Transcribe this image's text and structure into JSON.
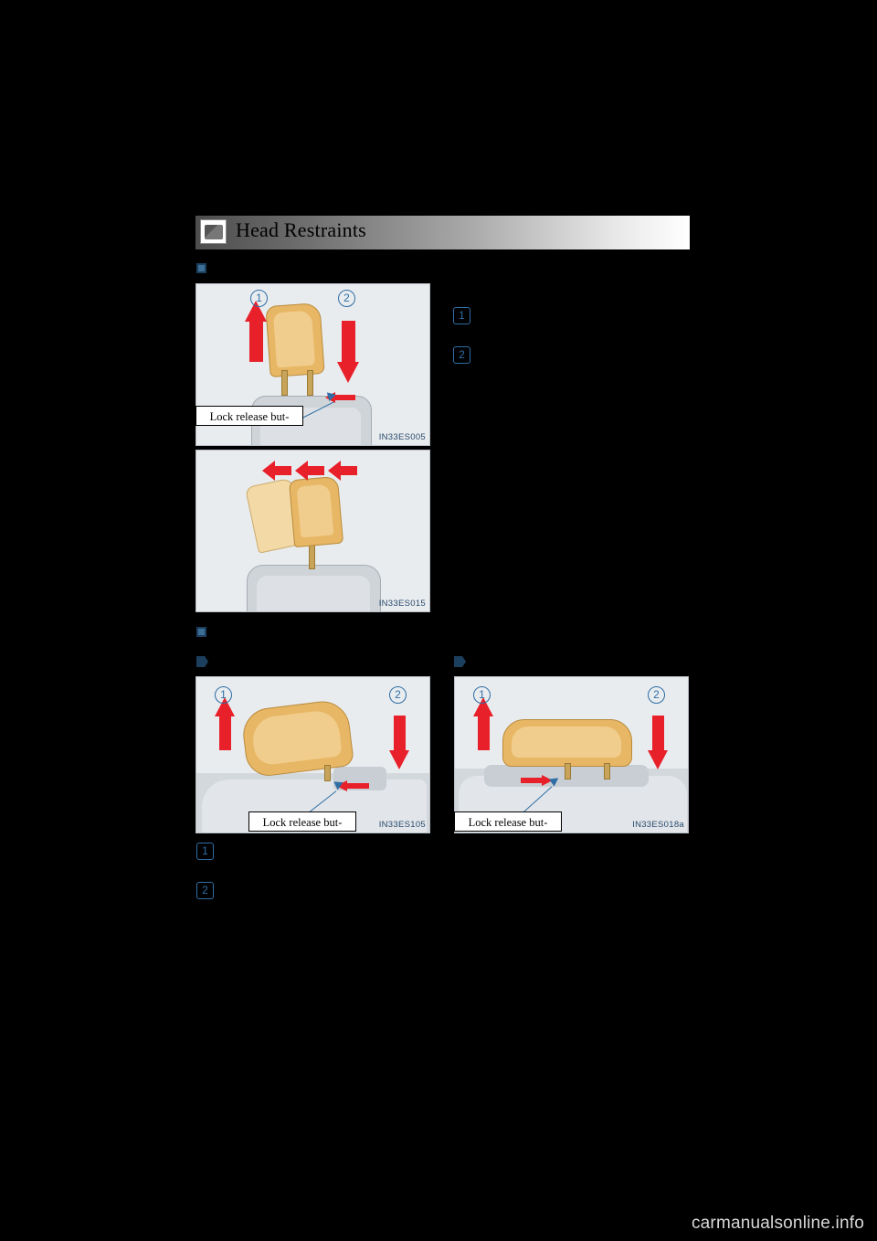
{
  "header": {
    "title": "Head Restraints",
    "icon": "seat-icon"
  },
  "sections": [
    {
      "marker": "section-marker",
      "figures": [
        {
          "code": "IN33ES005",
          "callout": "Lock  release  but-",
          "numbers": [
            "1",
            "2"
          ]
        },
        {
          "code": "IN33ES015",
          "callout": "",
          "numbers": []
        }
      ],
      "body_numbers": [
        "1",
        "2"
      ]
    },
    {
      "marker": "section-marker",
      "sub_figures": [
        {
          "marker": "sub-marker",
          "code": "IN33ES105",
          "callout": "Lock  release  but-",
          "numbers": [
            "1",
            "2"
          ]
        },
        {
          "marker": "sub-marker",
          "code": "IN33ES018a",
          "callout": "Lock  release  but-",
          "numbers": [
            "1",
            "2"
          ]
        }
      ],
      "body_numbers": [
        "1",
        "2"
      ]
    }
  ],
  "footer": {
    "watermark": "carmanualsonline.info"
  },
  "colors": {
    "accent_blue": "#2f6ea5",
    "arrow_red": "#e8202a",
    "headrest_tan": "#e8b765",
    "figure_bg": "#e9ecef",
    "page_bg": "#000000"
  }
}
